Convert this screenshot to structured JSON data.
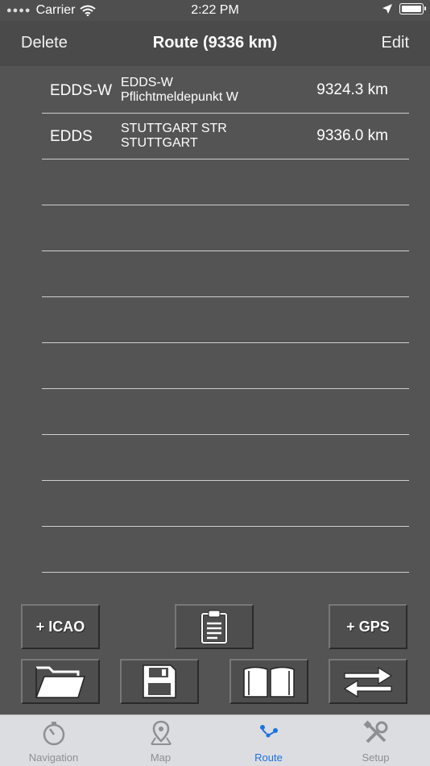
{
  "status_bar": {
    "carrier": "Carrier",
    "time": "2:22 PM"
  },
  "navbar": {
    "left": "Delete",
    "title": "Route (9336 km)",
    "right": "Edit"
  },
  "route": [
    {
      "ident": "EDDS-W",
      "name_line1": "EDDS-W",
      "name_line2": "Pflichtmeldepunkt W",
      "distance": "9324.3 km"
    },
    {
      "ident": "EDDS",
      "name_line1": "STUTTGART STR",
      "name_line2": "STUTTGART",
      "distance": "9336.0 km"
    }
  ],
  "buttons": {
    "add_icao": "+ ICAO",
    "add_gps": "+ GPS"
  },
  "tabs": [
    {
      "label": "Navigation",
      "icon": "stopwatch-icon"
    },
    {
      "label": "Map",
      "icon": "map-pin-icon"
    },
    {
      "label": "Route",
      "icon": "route-icon"
    },
    {
      "label": "Setup",
      "icon": "tools-icon"
    }
  ],
  "colors": {
    "accent": "#1a73e0",
    "background": "#545454"
  }
}
